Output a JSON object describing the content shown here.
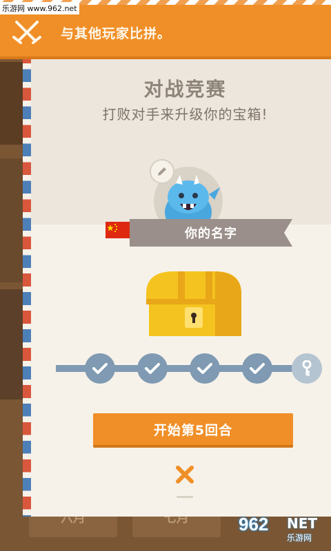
{
  "watermark_top": "乐游网 www.962.net",
  "banner": {
    "text": "与其他玩家比拼。",
    "icon": "crossed-swords-icon"
  },
  "card": {
    "title": "对战竞赛",
    "subtitle": "打败对手来升级你的宝箱!",
    "player_name": "你的名字",
    "flag": "china-flag"
  },
  "progress": {
    "completed_rounds": 4,
    "total_rounds": 5,
    "steps": [
      "check-icon",
      "check-icon",
      "check-icon",
      "check-icon",
      "key-icon"
    ]
  },
  "start_button": "开始第5回合",
  "background": {
    "months": [
      "六月",
      "七月"
    ]
  },
  "watermark_bottom": {
    "number": "962",
    "net": "NET",
    "site": "乐游网"
  },
  "colors": {
    "accent": "#f08f27",
    "card": "#f6f2ea",
    "step": "#7f9ab2",
    "ribbon": "#9a8f8a"
  }
}
